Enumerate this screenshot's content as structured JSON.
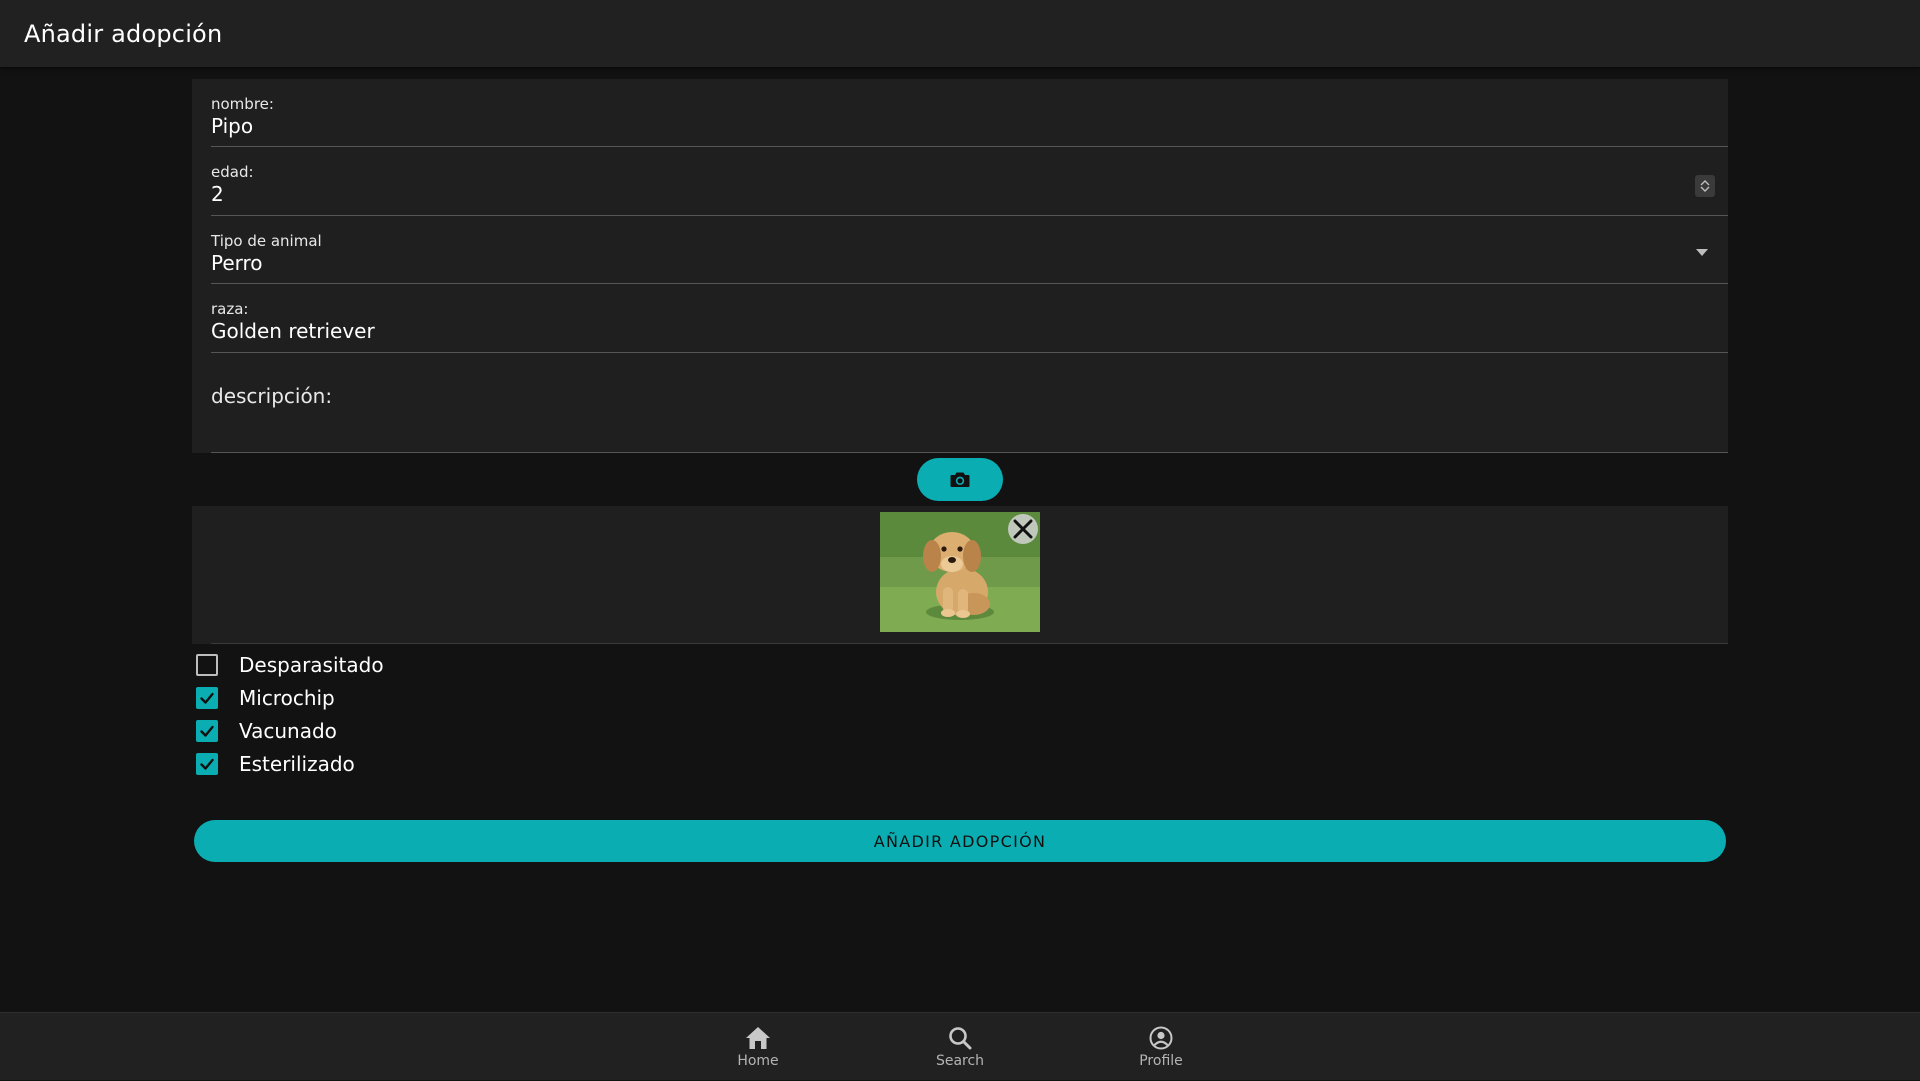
{
  "app_bar": {
    "title": "Añadir adopción"
  },
  "form": {
    "nombre": {
      "label": "nombre:",
      "value": "Pipo"
    },
    "edad": {
      "label": "edad:",
      "value": "2"
    },
    "tipo": {
      "label": "Tipo de animal",
      "value": "Perro"
    },
    "raza": {
      "label": "raza:",
      "value": "Golden retriever"
    },
    "descripcion": {
      "label": "descripción:",
      "value": ""
    }
  },
  "camera_button": {
    "icon": "camera-icon"
  },
  "photos": [
    {
      "subject": "golden retriever puppy on grass",
      "remove_icon": "close-icon"
    }
  ],
  "checkboxes": [
    {
      "label": "Desparasitado",
      "checked": false
    },
    {
      "label": "Microchip",
      "checked": true
    },
    {
      "label": "Vacunado",
      "checked": true
    },
    {
      "label": "Esterilizado",
      "checked": true
    }
  ],
  "submit_label": "AÑADIR ADOPCIÓN",
  "bottom_nav": [
    {
      "label": "Home",
      "icon": "home-icon"
    },
    {
      "label": "Search",
      "icon": "search-icon"
    },
    {
      "label": "Profile",
      "icon": "profile-icon"
    }
  ],
  "colors": {
    "accent": "#0aaeb2",
    "background": "#121212",
    "surface": "#1f1f1f",
    "app_bar": "#212121"
  }
}
